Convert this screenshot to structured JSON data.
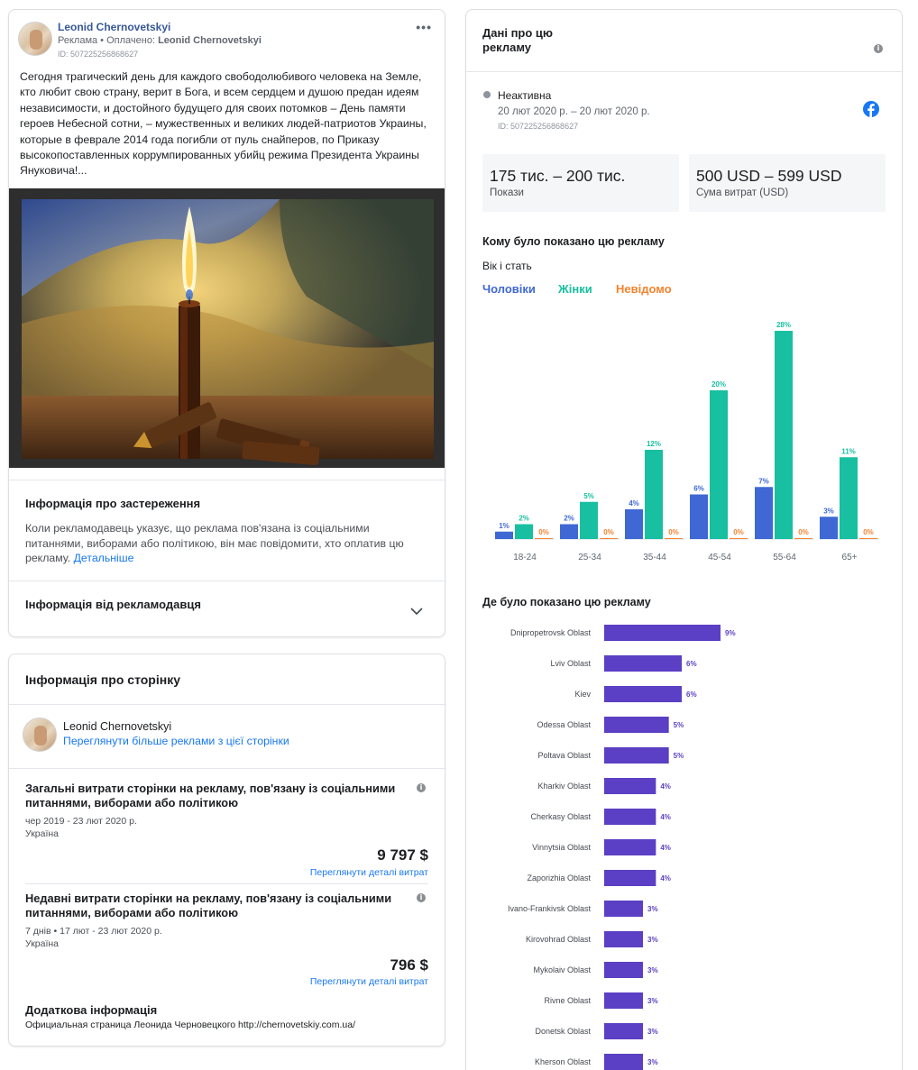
{
  "ad": {
    "author": "Leonid Chernovetskyi",
    "sponsor_prefix": "Реклама • Оплачено: ",
    "sponsor_name": "Leonid Chernovetskyi",
    "id_line": "ID: 507225256868627",
    "body": "Сегодня трагический день для каждого свободолюбивого человека на Земле, кто любит свою страну, верит в Бога, и всем сердцем и душою предан идеям независимости, и достойного будущего для своих потомков – День памяти героев Небесной сотни, – мужественных и великих людей-патриотов Украины, которые в феврале 2014 года погибли от пуль снайперов, по Приказу высокопоставленных коррумпированных убийц режима Президента Украины Януковича!...",
    "more_icon": "more-options-icon",
    "image_alt": "candle-and-bullets-image"
  },
  "disclaimer": {
    "title": "Інформація про застереження",
    "text": "Коли рекламодавець указує, що реклама пов'язана із соціальними питаннями, виборами або політикою, він має повідомити, хто оплатив цю рекламу.",
    "link": "Детальніше"
  },
  "advertiser": {
    "title": "Інформація від рекламодавця",
    "chevron_icon": "chevron-down-icon"
  },
  "page_info": {
    "title": "Інформація про сторінку",
    "page_name": "Leonid Chernovetskyi",
    "page_link": "Переглянути більше реклами з цієї сторінки",
    "total": {
      "title": "Загальні витрати сторінки на рекламу, пов'язану із соціальними питаннями, виборами або політикою",
      "period": "чер 2019 - 23 лют 2020 р.",
      "country": "Україна",
      "amount": "9 797 $",
      "link": "Переглянути деталі витрат"
    },
    "recent": {
      "title": "Недавні витрати сторінки на рекламу, пов'язану із соціальними питаннями, виборами або політикою",
      "period": "7 днів • 17 лют - 23 лют 2020 р.",
      "country": "Україна",
      "amount": "796 $",
      "link": "Переглянути деталі витрат"
    },
    "extra": {
      "title": "Додаткова інформація",
      "text": "Официальная страница Леонида Черновецкого http://chernovetskiy.com.ua/"
    }
  },
  "ad_data": {
    "title": "Дані про цю рекламу",
    "status": "Неактивна",
    "dates": "20 лют 2020 р. – 20 лют 2020 р.",
    "id_line": "ID: 507225256868627",
    "platform_icon": "facebook-icon",
    "impressions_value": "175 тис. – 200 тис.",
    "impressions_label": "Покази",
    "spend_value": "500 USD – 599 USD",
    "spend_label": "Сума витрат (USD)",
    "audience_title": "Кому було показано цю рекламу",
    "age_gender_title": "Вік і стать",
    "legend": {
      "men": "Чоловіки",
      "women": "Жінки",
      "unknown": "Невідомо"
    },
    "region_title": "Де було показано цю рекламу"
  },
  "colors": {
    "men": "#3f68d4",
    "women": "#18bfa0",
    "unknown": "#f5832f",
    "region": "#5b3fc4",
    "link": "#1877f2"
  },
  "chart_data": [
    {
      "type": "bar",
      "categories": [
        "18-24",
        "25-34",
        "35-44",
        "45-54",
        "55-64",
        "65+"
      ],
      "series": [
        {
          "name": "Чоловіки",
          "values": [
            1,
            2,
            4,
            6,
            7,
            3
          ],
          "labels": [
            "1%",
            "2%",
            "4%",
            "6%",
            "7%",
            "3%"
          ]
        },
        {
          "name": "Жінки",
          "values": [
            2,
            5,
            12,
            20,
            28,
            11
          ],
          "labels": [
            "2%",
            "5%",
            "12%",
            "20%",
            "28%",
            "11%"
          ]
        },
        {
          "name": "Невідомо",
          "values": [
            0,
            0,
            0,
            0,
            0,
            0
          ],
          "labels": [
            "0%",
            "0%",
            "0%",
            "0%",
            "0%",
            "0%"
          ]
        }
      ],
      "ylim": [
        0,
        28
      ],
      "grid": false,
      "legend": "top-left"
    },
    {
      "type": "bar",
      "orientation": "horizontal",
      "categories": [
        "Dnipropetrovsk Oblast",
        "Lviv Oblast",
        "Kiev",
        "Odessa Oblast",
        "Poltava Oblast",
        "Kharkiv Oblast",
        "Cherkasy Oblast",
        "Vinnytsia Oblast",
        "Zaporizhia Oblast",
        "Ivano-Frankivsk Oblast",
        "Kirovohrad Oblast",
        "Mykolaiv Oblast",
        "Rivne Oblast",
        "Donetsk Oblast",
        "Kherson Oblast"
      ],
      "values": [
        9,
        6,
        6,
        5,
        5,
        4,
        4,
        4,
        4,
        3,
        3,
        3,
        3,
        3,
        3
      ],
      "labels": [
        "9%",
        "6%",
        "6%",
        "5%",
        "5%",
        "4%",
        "4%",
        "4%",
        "4%",
        "3%",
        "3%",
        "3%",
        "3%",
        "3%",
        "3%"
      ],
      "xlim": [
        0,
        9
      ],
      "grid": false
    }
  ]
}
